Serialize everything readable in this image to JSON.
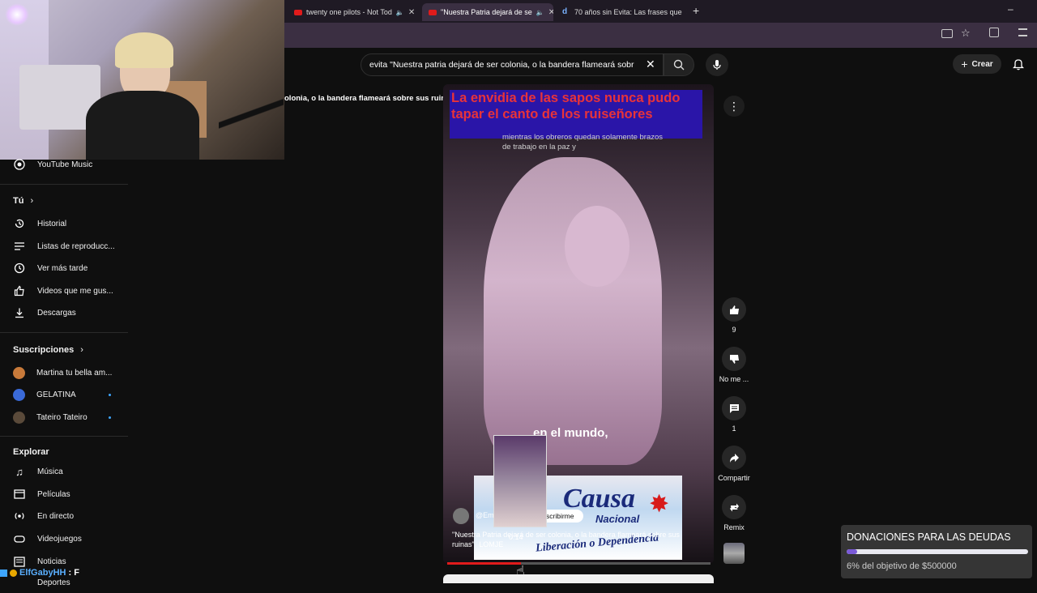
{
  "browser": {
    "tabs": [
      {
        "label": "twenty one pilots - Not Tod",
        "active": false
      },
      {
        "label": "\"Nuestra Patria dejará de se",
        "active": true
      },
      {
        "label": "70 años sin Evita: Las frases que",
        "active": false
      }
    ]
  },
  "header": {
    "search_value": "evita \"Nuestra patria dejará de ser colonia, o la bandera flameará sobr",
    "create_label": "Crear"
  },
  "sidebar": {
    "youtube_music": "YouTube Music",
    "you_heading": "Tú",
    "you_items": [
      {
        "label": "Historial",
        "icon": "history-icon"
      },
      {
        "label": "Listas de reproducc...",
        "icon": "playlist-icon"
      },
      {
        "label": "Ver más tarde",
        "icon": "clock-icon"
      },
      {
        "label": "Videos que me gus...",
        "icon": "thumb-up-icon"
      },
      {
        "label": "Descargas",
        "icon": "download-icon"
      }
    ],
    "subs_heading": "Suscripciones",
    "subs": [
      {
        "label": "Martina tu bella am...",
        "color": "#c87a3a"
      },
      {
        "label": "GELATINA",
        "color": "#3a6ad8"
      },
      {
        "label": "Tateiro Tateiro",
        "color": "#5a4a3a"
      }
    ],
    "explore_heading": "Explorar",
    "explore_items": [
      {
        "label": "Música",
        "icon": "music-icon"
      },
      {
        "label": "Películas",
        "icon": "film-icon"
      },
      {
        "label": "En directo",
        "icon": "live-icon"
      },
      {
        "label": "Videojuegos",
        "icon": "gamepad-icon"
      },
      {
        "label": "Noticias",
        "icon": "news-icon"
      },
      {
        "label": "Deportes",
        "icon": "trophy-icon"
      }
    ]
  },
  "short": {
    "marquee_title": "olonia, o la bandera flameará sobre sus ruinas\"",
    "overlay_title": "La envidia de las sapos nunca pudo tapar el canto de los ruiseñores",
    "subtitle_top": "mientras los obreros quedan solamente brazos de trabajo en la paz y",
    "caption": "en el mundo,",
    "channel": "@Em",
    "subscribe": "scribirme",
    "timestamp": "0:14",
    "logo_text": "Causa",
    "logo_sub": "Nacional",
    "logo_bottom": "Liberación o Dependencia",
    "title": "\"Nuestra Patria dejará de ser colonia, o la bandera flameará sobre sus ruinas\"",
    "title_tag": "LOMJE",
    "progress": 0.28
  },
  "actions": {
    "likes": "9",
    "dislike_label": "No me ...",
    "comments": "1",
    "share_label": "Compartir",
    "remix_label": "Remix"
  },
  "donation": {
    "title": "DONACIONES PARA LAS DEUDAS",
    "progress_text": "6% del objetivo de $500000",
    "progress": 0.06
  },
  "chat": {
    "user": "ElfGabyHH",
    "message": ": F"
  }
}
